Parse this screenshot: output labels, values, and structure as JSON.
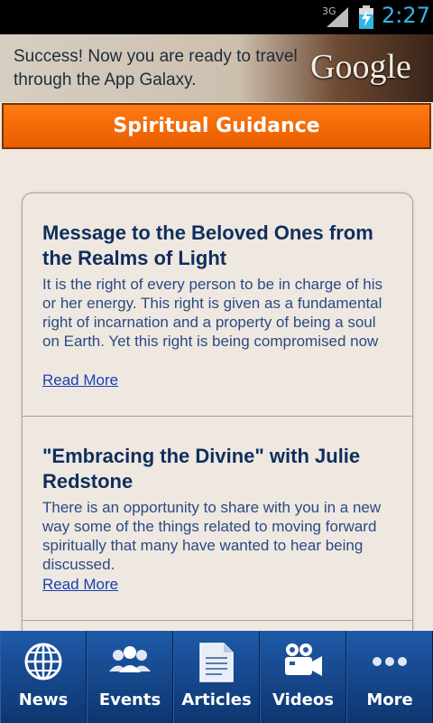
{
  "status": {
    "network": "3G",
    "time": "2:27"
  },
  "ad": {
    "text": "Success! Now you are ready to travel through the App Galaxy.",
    "brand": "Google"
  },
  "header": {
    "title": "Spiritual Guidance"
  },
  "articles": [
    {
      "title": "Message to the Beloved Ones from the Realms of Light",
      "body": "It is the right of every person to be in charge of his or her energy. This right is given as a fundamental right of incarnation and a property of being a soul on Earth. Yet this right is being compromised now",
      "link": "Read More"
    },
    {
      "title": "\"Embracing the Divine\" with Julie Redstone",
      "body": "There is an opportunity to share with you in a new way some of the things related to moving forward spiritually that many have wanted to hear being discussed.",
      "link": "Read More"
    }
  ],
  "tabs": [
    {
      "label": "News",
      "icon": "globe-icon"
    },
    {
      "label": "Events",
      "icon": "people-icon"
    },
    {
      "label": "Articles",
      "icon": "document-icon"
    },
    {
      "label": "Videos",
      "icon": "video-camera-icon"
    },
    {
      "label": "More",
      "icon": "more-dots-icon"
    }
  ],
  "colors": {
    "accent": "#ff7a12",
    "tabbar": "#103a78",
    "title_text": "#0f2e5e",
    "link": "#1a3fb5"
  }
}
